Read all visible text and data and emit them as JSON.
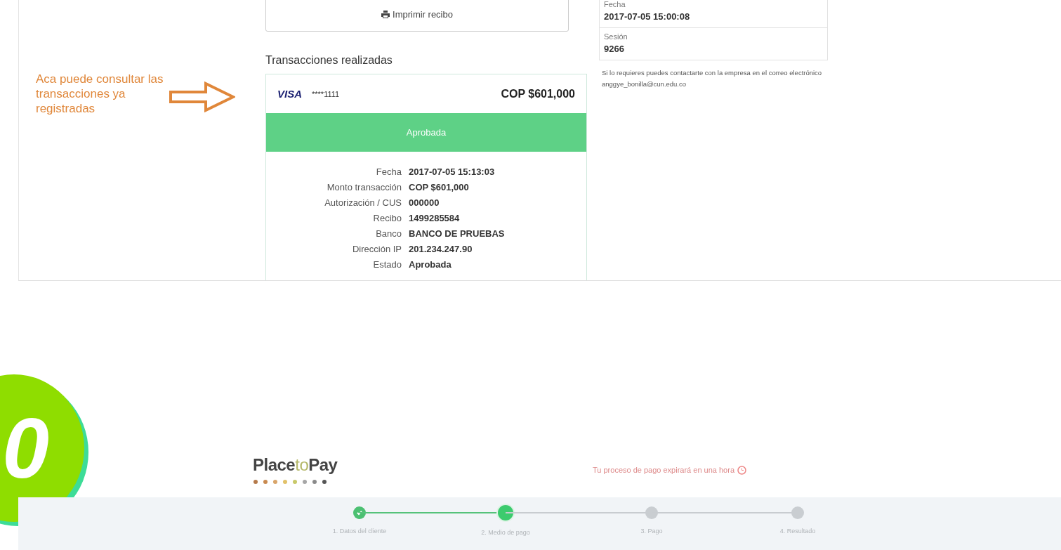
{
  "print_button": {
    "label": "Imprimir recibo"
  },
  "transactions": {
    "heading": "Transacciones realizadas",
    "card": {
      "brand": "VISA",
      "card_number": "****1111",
      "amount": "COP $601,000",
      "status": "Aprobada",
      "approved": true,
      "details": [
        {
          "label": "Fecha",
          "value": "2017-07-05 15:13:03"
        },
        {
          "label": "Monto transacción",
          "value": "COP $601,000"
        },
        {
          "label": "Autorización / CUS",
          "value": "000000"
        },
        {
          "label": "Recibo",
          "value": "1499285584"
        },
        {
          "label": "Banco",
          "value": "BANCO DE PRUEBAS"
        },
        {
          "label": "Dirección IP",
          "value": "201.234.247.90"
        },
        {
          "label": "Estado",
          "value": "Aprobada"
        }
      ]
    }
  },
  "session_info": {
    "fields": [
      {
        "label": "Fecha",
        "value": "2017-07-05 15:00:08"
      },
      {
        "label": "Sesión",
        "value": "9266"
      }
    ],
    "contact_note": "Si lo requieres puedes contactarte con la empresa en el correo electrónico anggye_bonilla@cun.edu.co"
  },
  "annotation": {
    "text": "Aca puede consultar las transacciones ya registradas"
  },
  "step_badge": {
    "number": "0"
  },
  "checkout": {
    "logo": {
      "part1": "Place",
      "part2": "to",
      "part3": "Pay"
    },
    "expiry_note": "Tu proceso de pago expirará en una hora",
    "steps": [
      {
        "label": "1. Datos del cliente",
        "done": true,
        "selected": false
      },
      {
        "label": "2. Medio de pago",
        "done": false,
        "selected": true
      },
      {
        "label": "3. Pago",
        "done": false,
        "selected": false
      },
      {
        "label": "4. Resultado",
        "done": false,
        "selected": false
      }
    ]
  }
}
